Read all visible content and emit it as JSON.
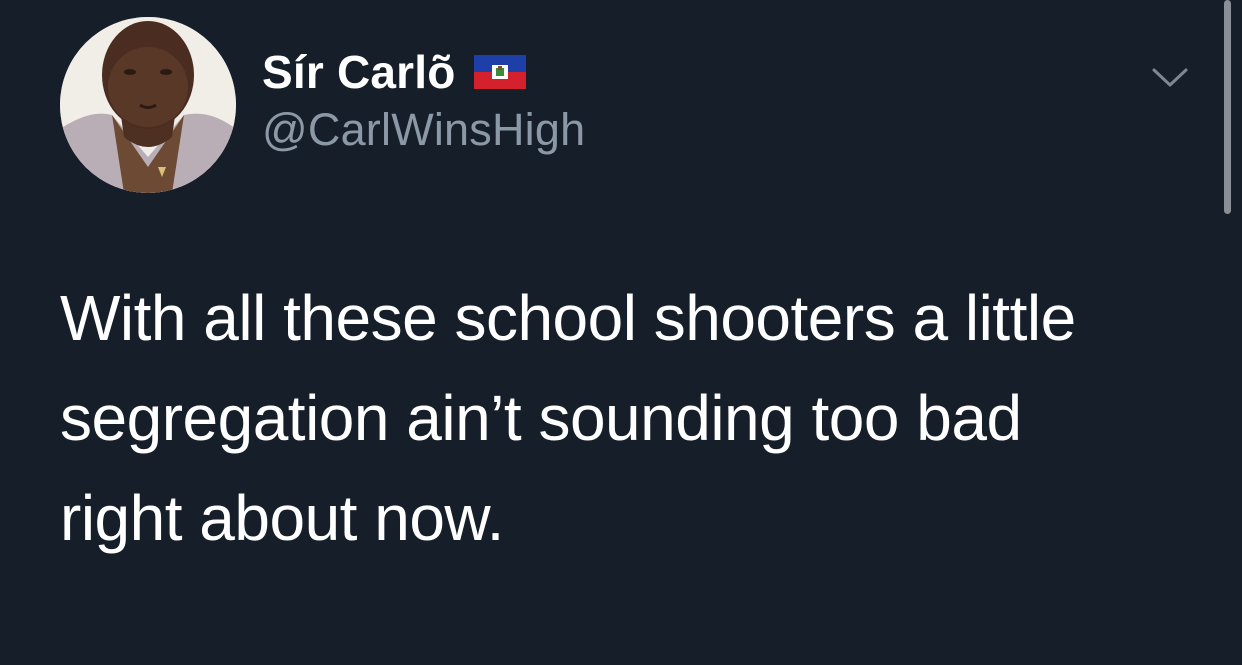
{
  "tweet": {
    "avatar_icon": "profile-photo",
    "display_name": "Sír Carlõ",
    "flag_icon": "haiti-flag-icon",
    "handle": "@CarlWinsHigh",
    "menu_icon": "chevron-down-icon",
    "text": "With all these school shooters a little\nsegregation ain’t sounding too bad\nright about now."
  },
  "colors": {
    "background": "#161e2a",
    "text_primary": "#ffffff",
    "text_secondary": "#8b98a5"
  }
}
